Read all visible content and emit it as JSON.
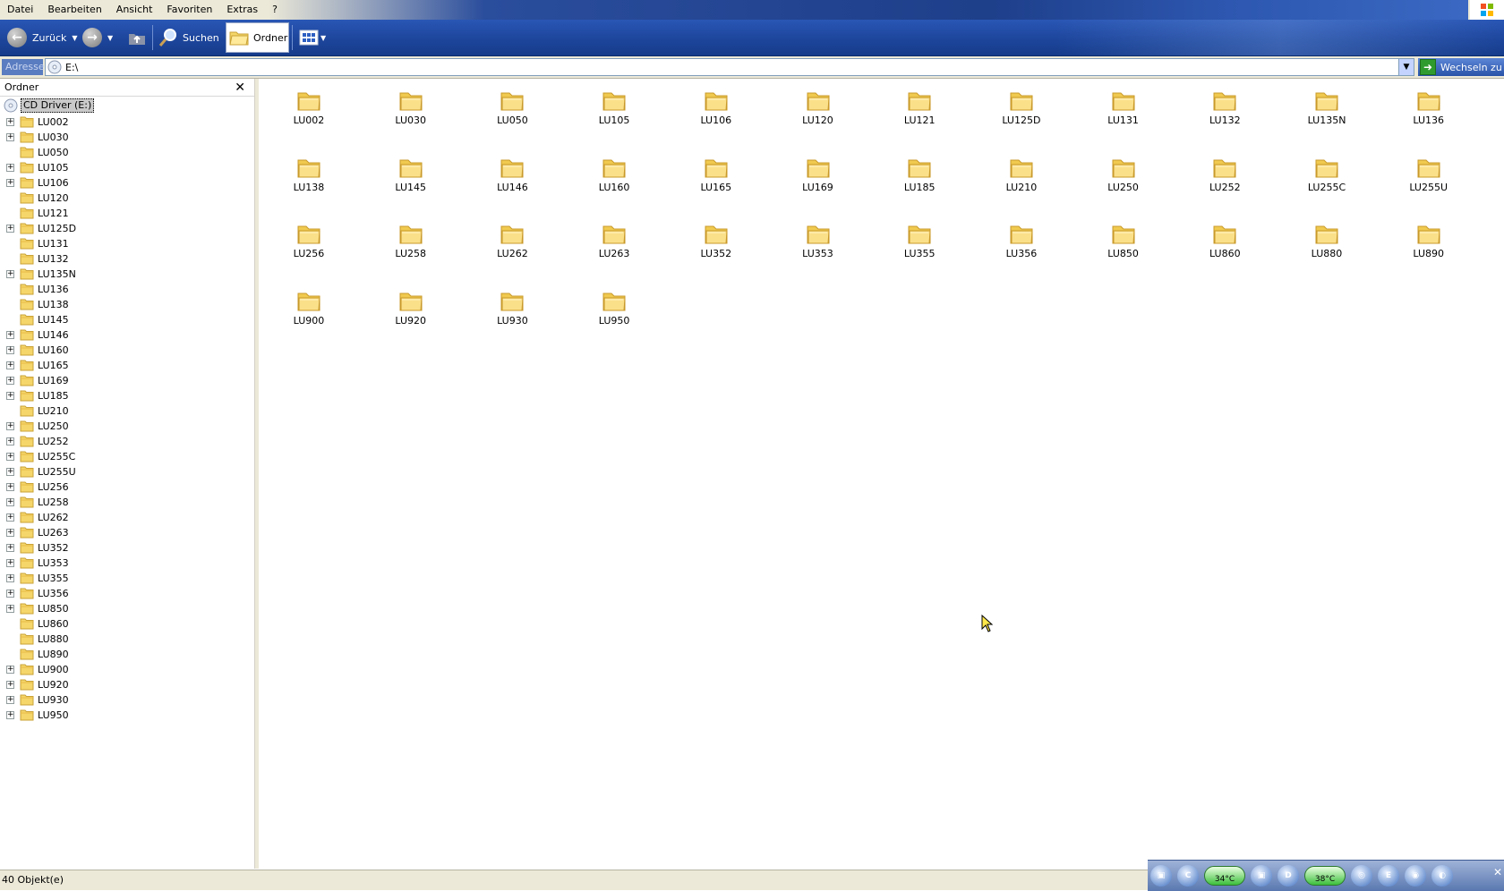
{
  "menu": [
    {
      "label": "Datei"
    },
    {
      "label": "Bearbeiten"
    },
    {
      "label": "Ansicht"
    },
    {
      "label": "Favoriten"
    },
    {
      "label": "Extras"
    },
    {
      "label": "?"
    }
  ],
  "toolbar": {
    "back_label": "Zurück",
    "search_label": "Suchen",
    "folders_label": "Ordner"
  },
  "address": {
    "label": "Adresse",
    "value": "E:\\",
    "go_label": "Wechseln zu"
  },
  "left_pane": {
    "title": "Ordner",
    "root_label": "CD Driver (E:)",
    "items": [
      {
        "label": "LU002",
        "expandable": true
      },
      {
        "label": "LU030",
        "expandable": true
      },
      {
        "label": "LU050",
        "expandable": false
      },
      {
        "label": "LU105",
        "expandable": true
      },
      {
        "label": "LU106",
        "expandable": true
      },
      {
        "label": "LU120",
        "expandable": false
      },
      {
        "label": "LU121",
        "expandable": false
      },
      {
        "label": "LU125D",
        "expandable": true
      },
      {
        "label": "LU131",
        "expandable": false
      },
      {
        "label": "LU132",
        "expandable": false
      },
      {
        "label": "LU135N",
        "expandable": true
      },
      {
        "label": "LU136",
        "expandable": false
      },
      {
        "label": "LU138",
        "expandable": false
      },
      {
        "label": "LU145",
        "expandable": false
      },
      {
        "label": "LU146",
        "expandable": true
      },
      {
        "label": "LU160",
        "expandable": true
      },
      {
        "label": "LU165",
        "expandable": true
      },
      {
        "label": "LU169",
        "expandable": true
      },
      {
        "label": "LU185",
        "expandable": true
      },
      {
        "label": "LU210",
        "expandable": false
      },
      {
        "label": "LU250",
        "expandable": true
      },
      {
        "label": "LU252",
        "expandable": true
      },
      {
        "label": "LU255C",
        "expandable": true
      },
      {
        "label": "LU255U",
        "expandable": true
      },
      {
        "label": "LU256",
        "expandable": true
      },
      {
        "label": "LU258",
        "expandable": true
      },
      {
        "label": "LU262",
        "expandable": true
      },
      {
        "label": "LU263",
        "expandable": true
      },
      {
        "label": "LU352",
        "expandable": true
      },
      {
        "label": "LU353",
        "expandable": true
      },
      {
        "label": "LU355",
        "expandable": true
      },
      {
        "label": "LU356",
        "expandable": true
      },
      {
        "label": "LU850",
        "expandable": true
      },
      {
        "label": "LU860",
        "expandable": false
      },
      {
        "label": "LU880",
        "expandable": false
      },
      {
        "label": "LU890",
        "expandable": false
      },
      {
        "label": "LU900",
        "expandable": true
      },
      {
        "label": "LU920",
        "expandable": true
      },
      {
        "label": "LU930",
        "expandable": true
      },
      {
        "label": "LU950",
        "expandable": true
      }
    ]
  },
  "content": {
    "items": [
      "LU002",
      "LU030",
      "LU050",
      "LU105",
      "LU106",
      "LU120",
      "LU121",
      "LU125D",
      "LU131",
      "LU132",
      "LU135N",
      "LU136",
      "LU138",
      "LU145",
      "LU146",
      "LU160",
      "LU165",
      "LU169",
      "LU185",
      "LU210",
      "LU250",
      "LU252",
      "LU255C",
      "LU255U",
      "LU256",
      "LU258",
      "LU262",
      "LU263",
      "LU352",
      "LU353",
      "LU355",
      "LU356",
      "LU850",
      "LU860",
      "LU880",
      "LU890",
      "LU900",
      "LU920",
      "LU930",
      "LU950"
    ]
  },
  "status": {
    "text": "40 Objekt(e)",
    "temp1": "34°C",
    "temp2": "38°C"
  },
  "colors": {
    "toolbar": "#1e479e",
    "folder": "#f5d66a",
    "chrome": "#ece9d8",
    "go_green": "#2f9b2f"
  }
}
